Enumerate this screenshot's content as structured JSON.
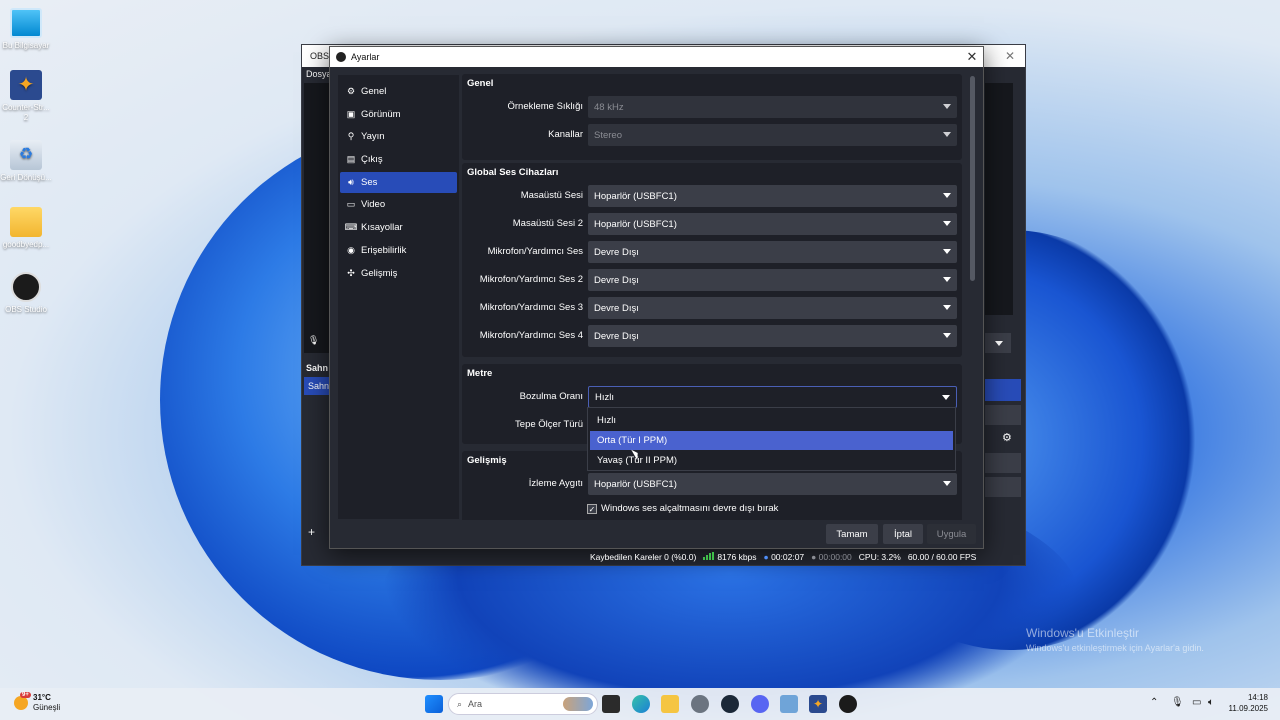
{
  "desktop": {
    "icons": [
      {
        "label": "Bu Bilgisayar"
      },
      {
        "label": "Counter-Str... 2"
      },
      {
        "label": "Geri Dönüşü..."
      },
      {
        "label": "goodbyedp..."
      },
      {
        "label": "OBS Studio"
      }
    ]
  },
  "obs_window": {
    "title": "OBS",
    "menu_first": "Dosya",
    "scenes_label": "Sahn",
    "scene_item": "Sahn"
  },
  "settings": {
    "title": "Ayarlar",
    "nav": [
      {
        "label": "Genel",
        "icon": "gear-icon"
      },
      {
        "label": "Görünüm",
        "icon": "appearance-icon"
      },
      {
        "label": "Yayın",
        "icon": "broadcast-icon"
      },
      {
        "label": "Çıkış",
        "icon": "output-icon"
      },
      {
        "label": "Ses",
        "icon": "speaker-icon"
      },
      {
        "label": "Video",
        "icon": "monitor-icon"
      },
      {
        "label": "Kısayollar",
        "icon": "keyboard-icon"
      },
      {
        "label": "Erişebilirlik",
        "icon": "accessibility-icon"
      },
      {
        "label": "Gelişmiş",
        "icon": "tools-icon"
      }
    ],
    "active_nav": "Ses",
    "genel": {
      "title": "Genel",
      "sample_rate_label": "Örnekleme Sıklığı",
      "sample_rate_value": "48 kHz",
      "channels_label": "Kanallar",
      "channels_value": "Stereo"
    },
    "global_audio": {
      "title": "Global Ses Cihazları",
      "rows": [
        {
          "label": "Masaüstü Sesi",
          "value": "Hoparlör (USBFC1)"
        },
        {
          "label": "Masaüstü Sesi 2",
          "value": "Hoparlör (USBFC1)"
        },
        {
          "label": "Mikrofon/Yardımcı Ses",
          "value": "Devre Dışı"
        },
        {
          "label": "Mikrofon/Yardımcı Ses 2",
          "value": "Devre Dışı"
        },
        {
          "label": "Mikrofon/Yardımcı Ses 3",
          "value": "Devre Dışı"
        },
        {
          "label": "Mikrofon/Yardımcı Ses 4",
          "value": "Devre Dışı"
        }
      ]
    },
    "meter": {
      "title": "Metre",
      "decay_label": "Bozulma Oranı",
      "decay_value": "Hızlı",
      "peak_label": "Tepe Ölçer Türü",
      "dropdown_options": [
        "Hızlı",
        "Orta (Tür I PPM)",
        "Yavaş (Tür II PPM)"
      ],
      "hovered_option": "Orta (Tür I PPM)"
    },
    "advanced": {
      "title": "Gelişmiş",
      "monitor_label": "İzleme Aygıtı",
      "monitor_value": "Hoparlör (USBFC1)",
      "ducking_checkbox": "Windows ses alçaltmasını devre dışı bırak",
      "ducking_checked": true
    },
    "buttons": {
      "ok": "Tamam",
      "cancel": "İptal",
      "apply": "Uygula"
    }
  },
  "statusbar": {
    "dropped_frames": "Kaybedilen Kareler 0 (%0.0)",
    "bitrate": "8176 kbps",
    "rec_time": "00:02:07",
    "stream_time": "00:00:00",
    "cpu": "CPU: 3.2%",
    "fps": "60.00 / 60.00 FPS"
  },
  "watermark": {
    "title": "Windows'u Etkinleştir",
    "subtitle": "Windows'u etkinleştirmek için Ayarlar'a gidin."
  },
  "taskbar": {
    "weather_temp": "31°C",
    "weather_desc": "Güneşli",
    "weather_badge": "9+",
    "search_placeholder": "Ara",
    "time": "14:18",
    "date": "11.09.2025"
  }
}
